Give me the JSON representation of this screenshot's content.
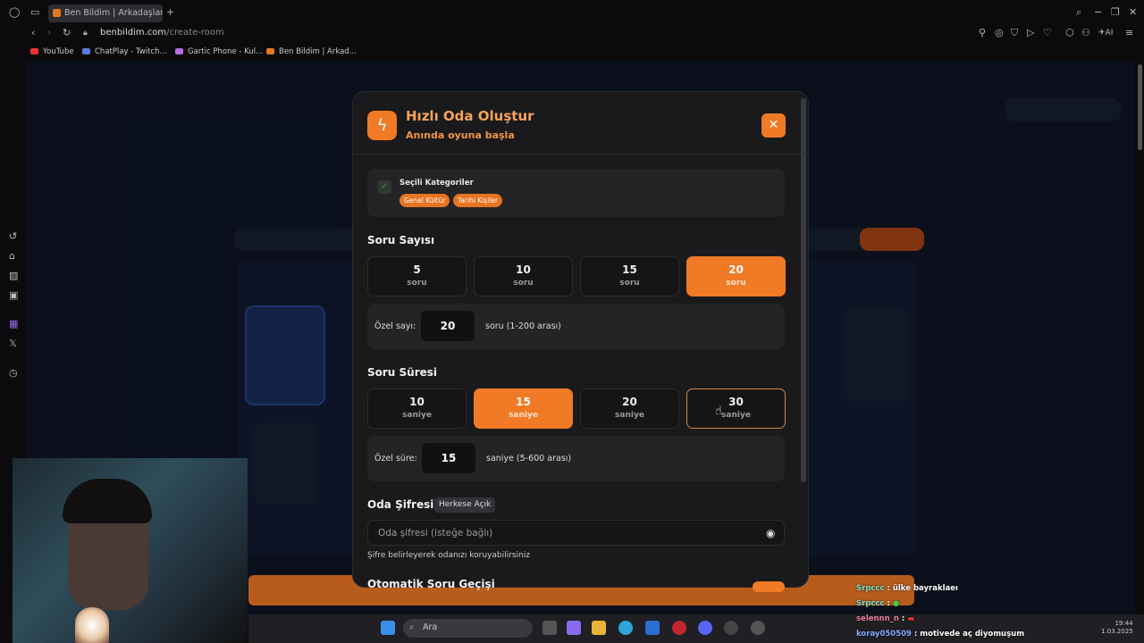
{
  "browser": {
    "tab_title": "Ben Bildim | Arkadaşlarınla",
    "url_host": "benbildim.com",
    "url_path": "/create-room",
    "bookmarks": [
      "YouTube",
      "ChatPlay - Twitch...",
      "Gartic Phone - Kul...",
      "Ben Bildim | Arkad..."
    ],
    "ai_label": "AI"
  },
  "modal": {
    "title": "Hızlı Oda Oluştur",
    "subtitle": "Anında oyuna başla",
    "categories": {
      "label": "Seçili Kategoriler",
      "chips": [
        "Genel Kültür",
        "Tarihi Kişiler"
      ]
    },
    "question_count": {
      "label": "Soru Sayısı",
      "unit": "soru",
      "options": [
        "5",
        "10",
        "15",
        "20"
      ],
      "selected": "20",
      "custom_label": "Özel sayı:",
      "custom_value": "20",
      "custom_hint": "soru (1-200 arası)"
    },
    "question_time": {
      "label": "Soru Süresi",
      "unit": "saniye",
      "options": [
        "10",
        "15",
        "20",
        "30"
      ],
      "selected": "15",
      "custom_label": "Özel süre:",
      "custom_value": "15",
      "custom_hint": "saniye (5-600 arası)"
    },
    "password": {
      "label": "Oda Şifresi",
      "badge": "Herkese Açık",
      "placeholder": "Oda şifresi (isteğe bağlı)",
      "hint": "Şifre belirleyerek odanızı koruyabilirsiniz"
    },
    "auto_next": {
      "label": "Otomatik Soru Geçişi",
      "enabled": true
    }
  },
  "taskbar": {
    "search_placeholder": "Ara",
    "time": "19:44",
    "date": "1.03.2025"
  },
  "chat": [
    {
      "user": "Srpccc",
      "text": "ülke bayraklaeı"
    },
    {
      "user": "Srpccc",
      "text": ""
    },
    {
      "user": "selennn_n",
      "text": ""
    },
    {
      "user": "koray050509",
      "text": "motivede aç diyomuşum"
    }
  ],
  "colors": {
    "accent": "#f07a25",
    "modal_bg": "#1a1a1c",
    "card_bg": "#242426"
  }
}
